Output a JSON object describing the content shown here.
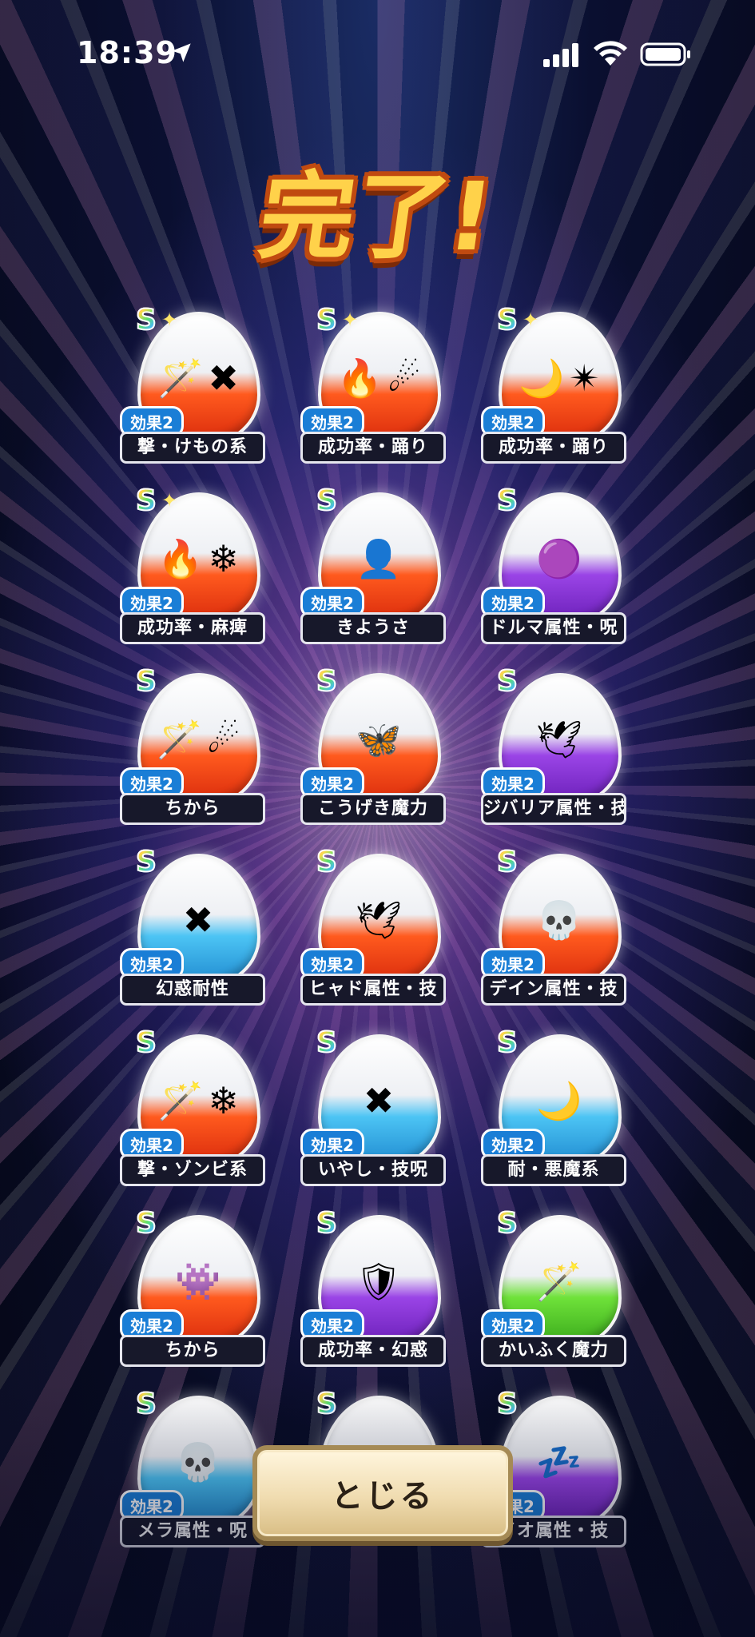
{
  "status_bar": {
    "time": "18:39"
  },
  "title": "完了!",
  "cards": [
    {
      "effect": "効果2",
      "label": "撃・けもの系",
      "egg": "red",
      "sparkle": true,
      "icons": [
        "🪄",
        "✖"
      ]
    },
    {
      "effect": "効果2",
      "label": "成功率・踊り",
      "egg": "red",
      "sparkle": true,
      "icons": [
        "🔥",
        "☄"
      ]
    },
    {
      "effect": "効果2",
      "label": "成功率・踊り",
      "egg": "red",
      "sparkle": true,
      "icons": [
        "🌙",
        "✴"
      ]
    },
    {
      "effect": "効果2",
      "label": "成功率・麻痺",
      "egg": "red",
      "sparkle": true,
      "icons": [
        "🔥",
        "❄"
      ]
    },
    {
      "effect": "効果2",
      "label": "きようさ",
      "egg": "red",
      "sparkle": false,
      "icons": [
        "👤"
      ]
    },
    {
      "effect": "効果2",
      "label": "ドルマ属性・呪",
      "egg": "purple",
      "sparkle": false,
      "icons": [
        "🟣"
      ]
    },
    {
      "effect": "効果2",
      "label": "ちから",
      "egg": "red",
      "sparkle": false,
      "icons": [
        "🪄",
        "☄"
      ]
    },
    {
      "effect": "効果2",
      "label": "こうげき魔力",
      "egg": "red",
      "sparkle": false,
      "icons": [
        "🦋"
      ]
    },
    {
      "effect": "効果2",
      "label": "ジバリア属性・技",
      "egg": "purple",
      "sparkle": false,
      "icons": [
        "🕊"
      ]
    },
    {
      "effect": "効果2",
      "label": "幻惑耐性",
      "egg": "blue",
      "sparkle": false,
      "icons": [
        "✖"
      ]
    },
    {
      "effect": "効果2",
      "label": "ヒャド属性・技",
      "egg": "red",
      "sparkle": false,
      "icons": [
        "🕊"
      ]
    },
    {
      "effect": "効果2",
      "label": "デイン属性・技",
      "egg": "red",
      "sparkle": false,
      "icons": [
        "💀"
      ]
    },
    {
      "effect": "効果2",
      "label": "撃・ゾンビ系",
      "egg": "red",
      "sparkle": false,
      "icons": [
        "🪄",
        "❄"
      ]
    },
    {
      "effect": "効果2",
      "label": "いやし・技呪",
      "egg": "blue",
      "sparkle": false,
      "icons": [
        "✖"
      ]
    },
    {
      "effect": "効果2",
      "label": "耐・悪魔系",
      "egg": "blue",
      "sparkle": false,
      "icons": [
        "🌙"
      ]
    },
    {
      "effect": "効果2",
      "label": "ちから",
      "egg": "red",
      "sparkle": false,
      "icons": [
        "👾"
      ]
    },
    {
      "effect": "効果2",
      "label": "成功率・幻惑",
      "egg": "purple",
      "sparkle": false,
      "icons": [
        "🛡"
      ]
    },
    {
      "effect": "効果2",
      "label": "かいふく魔力",
      "egg": "green",
      "sparkle": false,
      "icons": [
        "🪄"
      ]
    },
    {
      "effect": "効果2",
      "label": "メラ属性・呪",
      "egg": "blue",
      "sparkle": false,
      "icons": [
        "💀"
      ]
    },
    {
      "effect": "",
      "label": "",
      "egg": "green",
      "sparkle": false,
      "icons": []
    },
    {
      "effect": "効果2",
      "label": "イオ属性・技",
      "egg": "purple",
      "sparkle": false,
      "icons": [
        "💤"
      ]
    }
  ],
  "close_button": {
    "label": "とじる"
  }
}
